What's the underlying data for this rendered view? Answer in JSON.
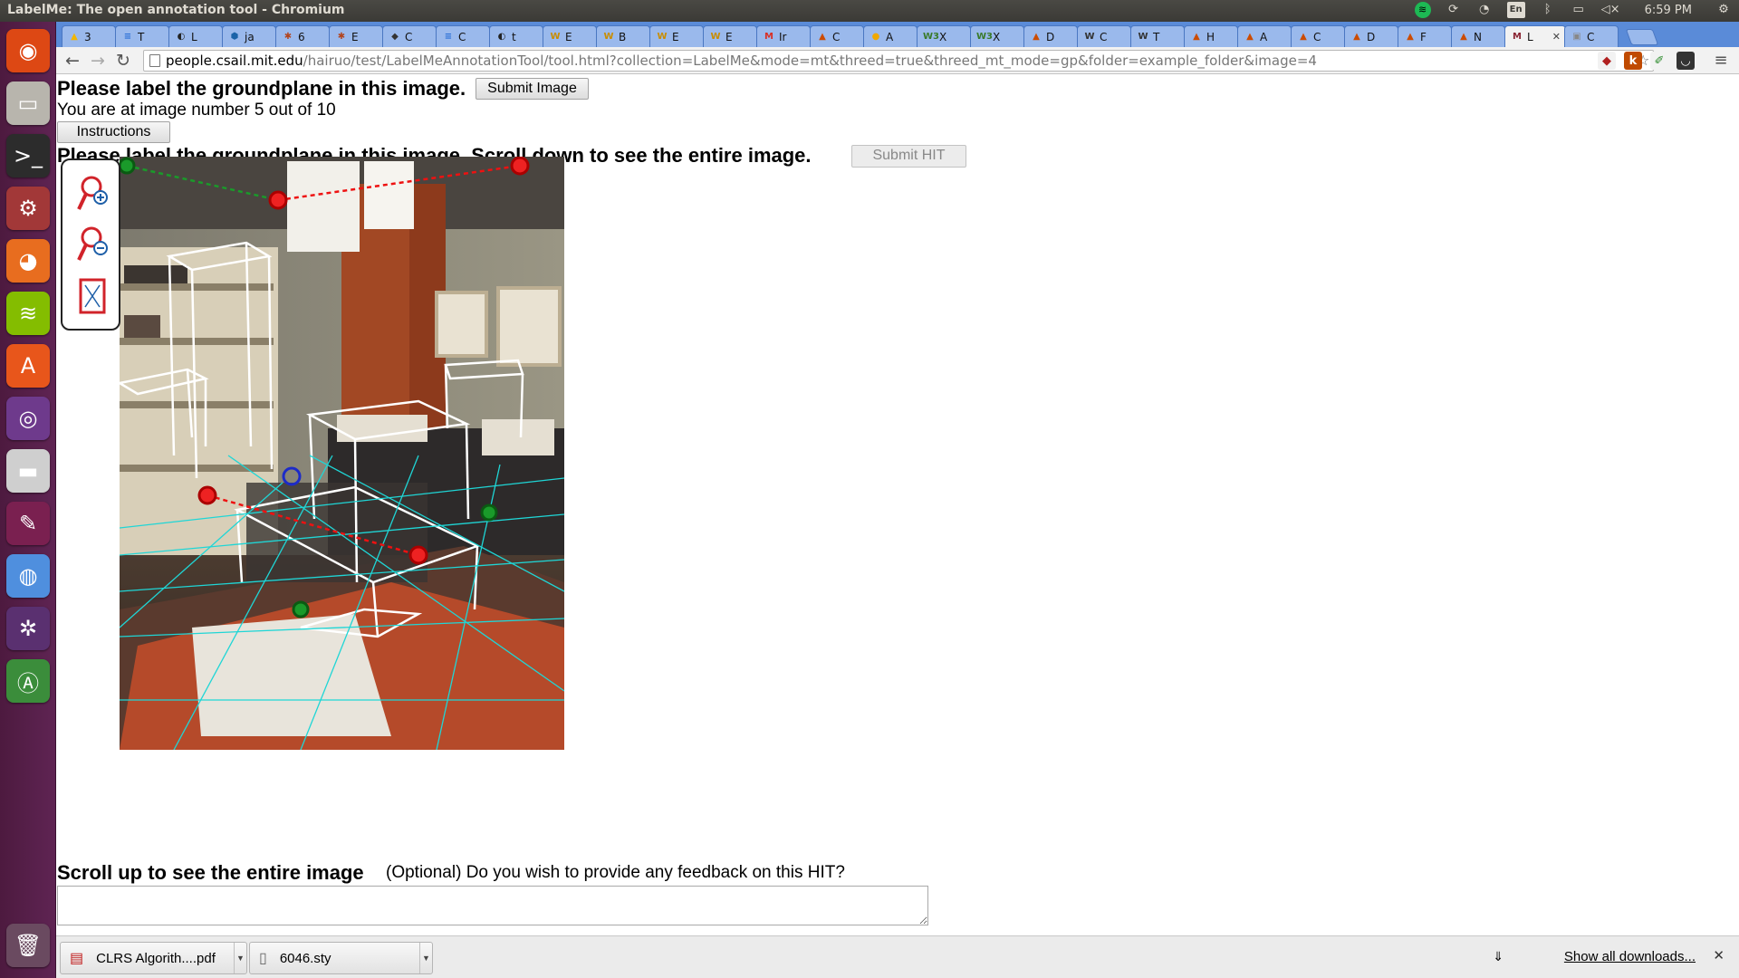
{
  "window": {
    "title": "LabelMe: The open annotation tool - Chromium"
  },
  "panel": {
    "clock": "6:59 PM",
    "keyboard": "En"
  },
  "launcher": {
    "items": [
      {
        "name": "ubuntu-dash",
        "glyph": "◉",
        "bg": "#dd4814"
      },
      {
        "name": "files",
        "glyph": "▭",
        "bg": "#b8b5ad"
      },
      {
        "name": "terminal",
        "glyph": ">_",
        "bg": "#2c2c2c"
      },
      {
        "name": "system-settings",
        "glyph": "⚙",
        "bg": "#a23838"
      },
      {
        "name": "firefox",
        "glyph": "◕",
        "bg": "#e86d1f"
      },
      {
        "name": "spotify",
        "glyph": "≋",
        "bg": "#84bd00"
      },
      {
        "name": "software-center",
        "glyph": "A",
        "bg": "#e8561b"
      },
      {
        "name": "app-ring",
        "glyph": "◎",
        "bg": "#6e3a8c"
      },
      {
        "name": "disk",
        "glyph": "▬",
        "bg": "#cfcfcf"
      },
      {
        "name": "draw",
        "glyph": "✎",
        "bg": "#7a2050"
      },
      {
        "name": "chromium",
        "glyph": "◍",
        "bg": "#4f8fde"
      },
      {
        "name": "shotwell",
        "glyph": "✲",
        "bg": "#5a3070"
      },
      {
        "name": "update-manager",
        "glyph": "Ⓐ",
        "bg": "#3b8d3b"
      },
      {
        "name": "trash",
        "glyph": "🗑",
        "bg": "#6a4a60"
      }
    ]
  },
  "tabs": [
    {
      "label": "3",
      "fav": "▲",
      "favc": "#f3b600"
    },
    {
      "label": "T",
      "fav": "≡",
      "favc": "#2a6fd6"
    },
    {
      "label": "L",
      "fav": "◐",
      "favc": "#222"
    },
    {
      "label": "ja",
      "fav": "⬢",
      "favc": "#1b63a8"
    },
    {
      "label": "6",
      "fav": "✱",
      "favc": "#b2451f"
    },
    {
      "label": "E",
      "fav": "✱",
      "favc": "#b2451f"
    },
    {
      "label": "C",
      "fav": "◆",
      "favc": "#333"
    },
    {
      "label": "C",
      "fav": "≡",
      "favc": "#2a6fd6"
    },
    {
      "label": "t",
      "fav": "◐",
      "favc": "#222"
    },
    {
      "label": "E",
      "fav": "W",
      "favc": "#c98d00"
    },
    {
      "label": "B",
      "fav": "W",
      "favc": "#c98d00"
    },
    {
      "label": "E",
      "fav": "W",
      "favc": "#c98d00"
    },
    {
      "label": "E",
      "fav": "W",
      "favc": "#c98d00"
    },
    {
      "label": "Ir",
      "fav": "M",
      "favc": "#d93025"
    },
    {
      "label": "C",
      "fav": "▲",
      "favc": "#cc4b00"
    },
    {
      "label": "A",
      "fav": "●",
      "favc": "#f0a800"
    },
    {
      "label": "X",
      "fav": "W3",
      "favc": "#3a7a2a"
    },
    {
      "label": "X",
      "fav": "W3",
      "favc": "#3a7a2a"
    },
    {
      "label": "D",
      "fav": "▲",
      "favc": "#cc4b00"
    },
    {
      "label": "C",
      "fav": "W",
      "favc": "#333"
    },
    {
      "label": "T",
      "fav": "W",
      "favc": "#333"
    },
    {
      "label": "H",
      "fav": "▲",
      "favc": "#cc4b00"
    },
    {
      "label": "A",
      "fav": "▲",
      "favc": "#cc4b00"
    },
    {
      "label": "C",
      "fav": "▲",
      "favc": "#cc4b00"
    },
    {
      "label": "D",
      "fav": "▲",
      "favc": "#cc4b00"
    },
    {
      "label": "F",
      "fav": "▲",
      "favc": "#cc4b00"
    },
    {
      "label": "N",
      "fav": "▲",
      "favc": "#cc4b00"
    },
    {
      "label": "L",
      "fav": "M",
      "favc": "#8a2432",
      "active": true
    },
    {
      "label": "C",
      "fav": "▣",
      "favc": "#888"
    }
  ],
  "omnibox": {
    "host": "people.csail.mit.edu",
    "path": "/hairuo/test/LabelMeAnnotationTool/tool.html?collection=LabelMe&mode=mt&threed=true&threed_mt_mode=gp&folder=example_folder&image=4"
  },
  "extensions": [
    {
      "name": "ext-labelme",
      "glyph": "◆",
      "bg": "#f2f2f2",
      "fg": "#b02020"
    },
    {
      "name": "ext-k",
      "glyph": "k",
      "bg": "#c04a00",
      "fg": "#fff"
    },
    {
      "name": "ext-shield",
      "glyph": "✐",
      "bg": "#f2f2f2",
      "fg": "#2a8a2a"
    },
    {
      "name": "ext-pocket",
      "glyph": "◡",
      "bg": "#333",
      "fg": "#fff"
    }
  ],
  "page": {
    "header_title": "Please label the groundplane in this image.",
    "submit_image": "Submit Image",
    "progress": "You are at image number 5 out of 10",
    "instructions": "Instructions",
    "scroll_down": "Please label the groundplane in this image. Scroll down to see the entire image.",
    "submit_hit": "Submit HIT",
    "scroll_up": "Scroll up to see the entire image",
    "feedback_prompt": "(Optional) Do you wish to provide any feedback on this HIT?",
    "feedback_value": ""
  },
  "downloads": {
    "items": [
      "CLRS Algorith....pdf",
      "6046.sty"
    ],
    "show_all": "Show all downloads..."
  }
}
